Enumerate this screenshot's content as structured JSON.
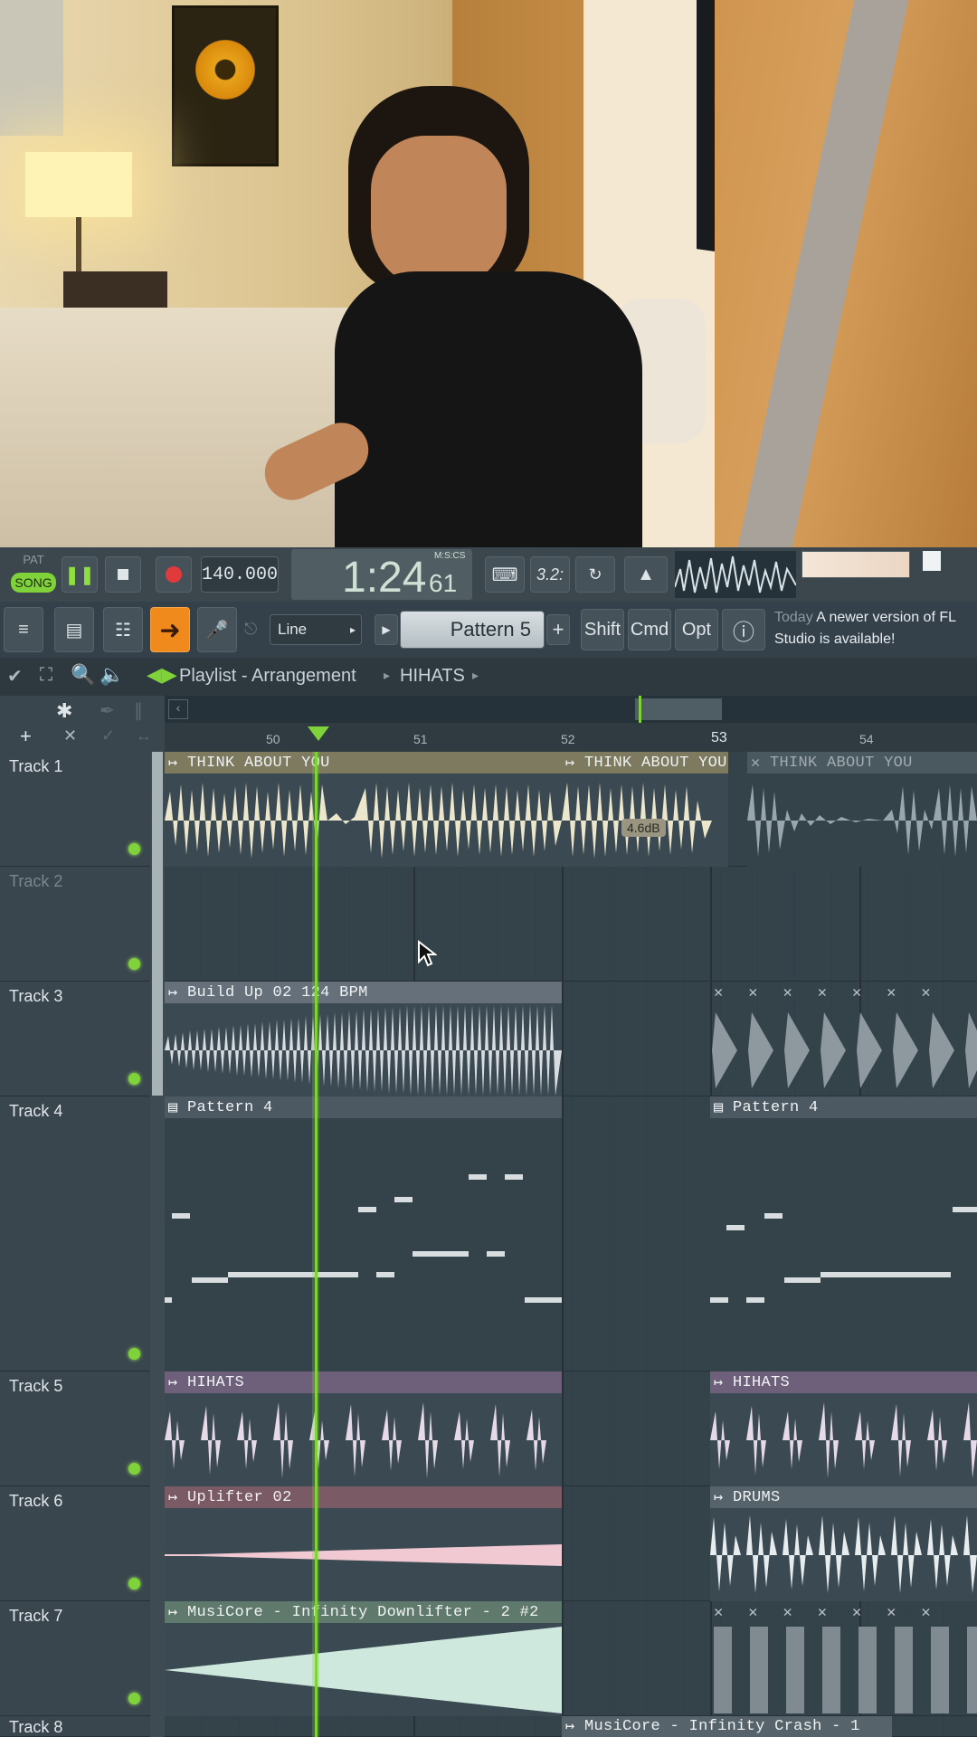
{
  "transport": {
    "mode_pat": "PAT",
    "mode_song": "SONG",
    "tempo": "140.000",
    "time_main": "1:24",
    "time_sub": "61",
    "time_format": "M:S:CS",
    "numerator": "3.2:"
  },
  "toolbar": {
    "snap": "Line",
    "pattern": "Pattern 5",
    "shift": "Shift",
    "cmd": "Cmd",
    "opt": "Opt",
    "news_today": "Today",
    "news_text": "A newer version of FL Studio is available!"
  },
  "playlist": {
    "title": "Playlist - Arrangement",
    "crumb": "HIHATS",
    "ruler": [
      "50",
      "51",
      "52",
      "53",
      "54"
    ]
  },
  "tracks": [
    {
      "name": "Track 1"
    },
    {
      "name": "Track 2"
    },
    {
      "name": "Track 3"
    },
    {
      "name": "Track 4"
    },
    {
      "name": "Track 5"
    },
    {
      "name": "Track 6"
    },
    {
      "name": "Track 7"
    },
    {
      "name": "Track 8"
    }
  ],
  "clips": {
    "t1a": "THINK ABOUT YOU",
    "t1b": "THINK ABOUT YOU",
    "t1c": "THINK ABOUT YOU",
    "t1_gain": "4.6dB",
    "t3a": "Build Up 02 124 BPM",
    "t4a": "Pattern 4",
    "t4b": "Pattern 4",
    "t5a": "HIHATS",
    "t5b": "HIHATS",
    "t6a": "Uplifter 02",
    "t6b": "DRUMS",
    "t7a": "MusiCore - Infinity Downlifter - 2 #2",
    "t8a": "MusiCore - Infinity Crash - 1"
  },
  "colors": {
    "accent_orange": "#f08a1d",
    "playhead_green": "#7fd23a",
    "record_red": "#e03a3a"
  }
}
